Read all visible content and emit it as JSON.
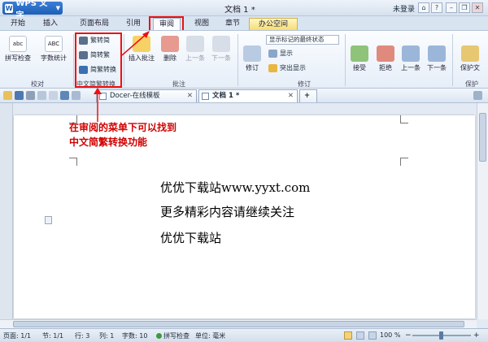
{
  "app": {
    "name": "WPS 文字",
    "title": "文档 1 *",
    "login": "未登录"
  },
  "menu": {
    "tabs": [
      "开始",
      "插入",
      "页面布局",
      "引用",
      "审阅",
      "视图",
      "章节",
      "办公空间"
    ],
    "active": "审阅"
  },
  "ribbon": {
    "proof": {
      "spell": "拼写检查",
      "count": "字数统计",
      "group": "校对",
      "abc1": "abc",
      "abc2": "ABC"
    },
    "chinese": {
      "to_simplified": "繁转简",
      "to_traditional": "简转繁",
      "convert": "简繁转换",
      "group": "中文简繁转换"
    },
    "comments": {
      "insert": "插入批注",
      "delete": "删除",
      "prev": "上一条",
      "next": "下一条",
      "group": "批注"
    },
    "track": {
      "combo": "显示标记的最终状态",
      "edit": "修订",
      "show": "显示",
      "highlight": "突出显示",
      "group": "修订"
    },
    "changes": {
      "accept": "接受",
      "reject": "拒绝",
      "prev": "上一条",
      "next": "下一条",
      "protect": "保护文",
      "group": "保护"
    }
  },
  "tabs": [
    {
      "label": "Docer-在线模板"
    },
    {
      "label": "文档 1 *"
    }
  ],
  "document": {
    "annotation": [
      "在审阅的菜单下可以找到",
      "中文简繁转换功能"
    ],
    "lines": [
      "优优下载站www.yyxt.com",
      "更多精彩内容请继续关注",
      "优优下载站"
    ]
  },
  "status": {
    "page": "页面: 1/1",
    "section": "节: 1/1",
    "row": "行: 3",
    "col": "列: 1",
    "words": "字数: 10",
    "spell": "拼写检查",
    "unit": "单位: 毫米",
    "zoom": "100 %"
  },
  "colors": {
    "accent": "#1f5fb6",
    "annotation": "#d10000",
    "highlight_box": "#ee1111"
  }
}
